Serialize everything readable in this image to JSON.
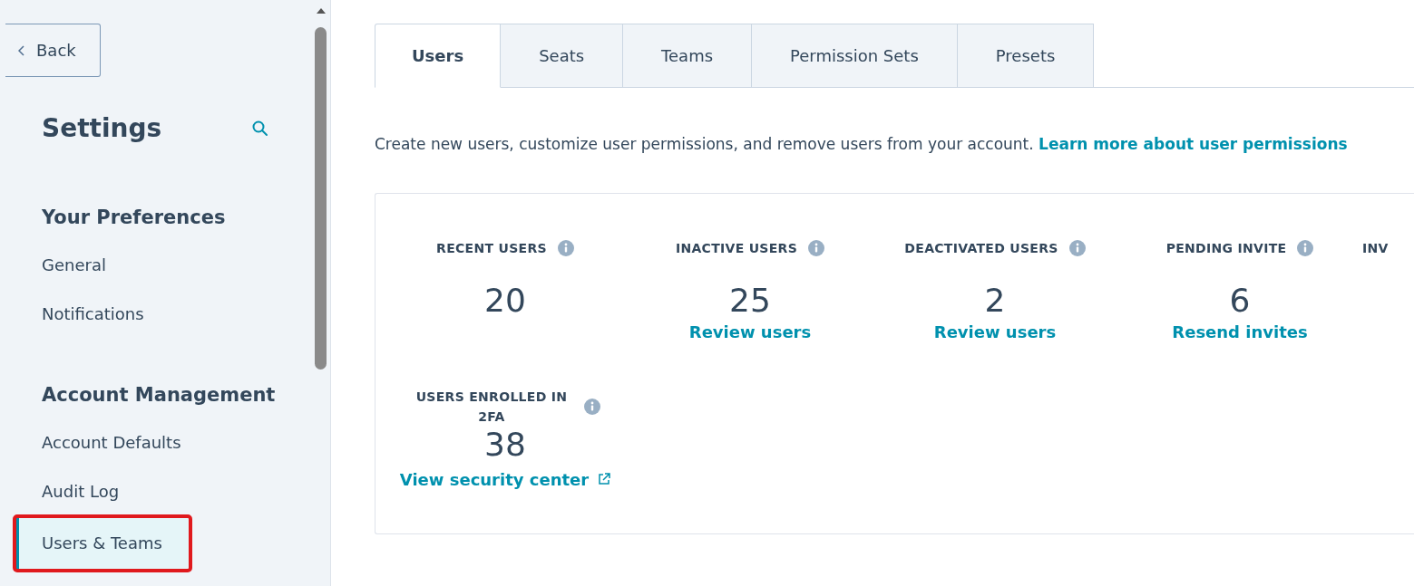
{
  "sidebar": {
    "back_button": "Back",
    "title": "Settings",
    "sections": [
      {
        "heading": "Your Preferences",
        "items": [
          {
            "label": "General",
            "selected": false,
            "annotated": false
          },
          {
            "label": "Notifications",
            "selected": false,
            "annotated": false
          }
        ]
      },
      {
        "heading": "Account Management",
        "items": [
          {
            "label": "Account Defaults",
            "selected": false,
            "annotated": false
          },
          {
            "label": "Audit Log",
            "selected": false,
            "annotated": false
          },
          {
            "label": "Users & Teams",
            "selected": true,
            "annotated": true
          }
        ]
      }
    ]
  },
  "tabs": [
    {
      "label": "Users",
      "selected": true
    },
    {
      "label": "Seats",
      "selected": false
    },
    {
      "label": "Teams",
      "selected": false
    },
    {
      "label": "Permission Sets",
      "selected": false
    },
    {
      "label": "Presets",
      "selected": false
    }
  ],
  "description": {
    "text": "Create new users, customize user permissions, and remove users from your account.",
    "link": "Learn more about user permissions"
  },
  "stats": [
    {
      "label": "RECENT USERS",
      "value": "20"
    },
    {
      "label": "INACTIVE USERS",
      "value": "25",
      "link": "Review users"
    },
    {
      "label": "DEACTIVATED USERS",
      "value": "2",
      "link": "Review users"
    },
    {
      "label": "PENDING INVITE",
      "value": "6",
      "link": "Resend invites"
    },
    {
      "label": "INV"
    },
    {
      "label": "USERS ENROLLED IN 2FA",
      "value": "38",
      "link": "View security center",
      "external": true
    }
  ]
}
